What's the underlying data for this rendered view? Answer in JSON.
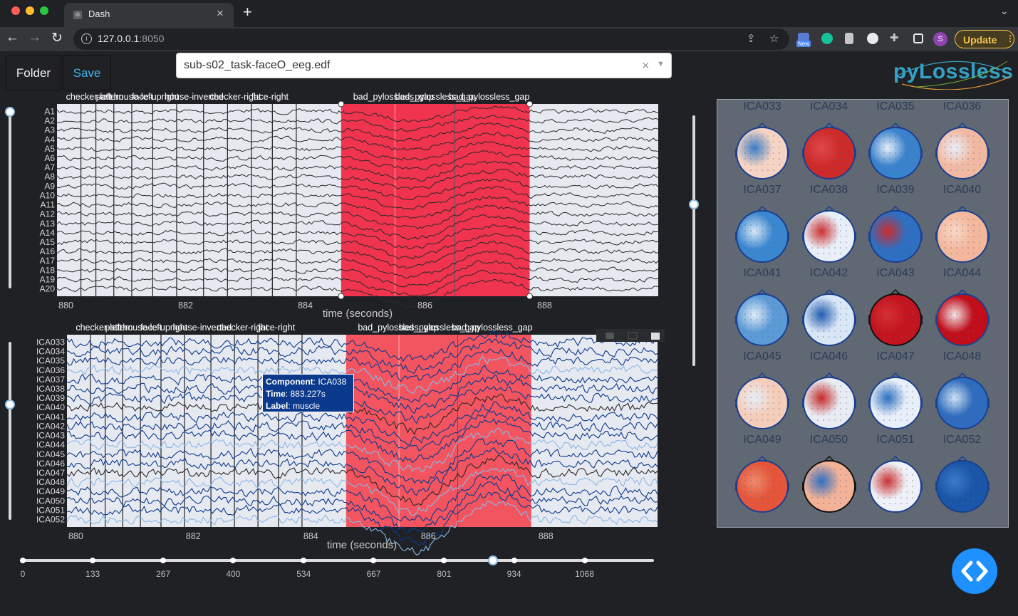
{
  "browser": {
    "tab_title": "Dash",
    "url_host": "127.0.0.1",
    "url_port": ":8050",
    "update_label": "Update",
    "new_badge": "New",
    "profile_initial": "S"
  },
  "app": {
    "folder_label": "Folder",
    "save_label": "Save",
    "file_value": "sub-s02_task-faceO_eeg.edf",
    "logo_text": "pyLossless"
  },
  "eeg_plot": {
    "channels": [
      "A1",
      "A2",
      "A3",
      "A4",
      "A5",
      "A6",
      "A7",
      "A8",
      "A9",
      "A10",
      "A11",
      "A12",
      "A13",
      "A14",
      "A15",
      "A16",
      "A17",
      "A18",
      "A19",
      "A20"
    ],
    "x_ticks": [
      "880",
      "882",
      "884",
      "886",
      "888"
    ],
    "x_label": "time (seconds)",
    "annotations": [
      "checker-left",
      "pattern",
      "house-left",
      "face-upright",
      "house-inverted",
      "checker-right",
      "face-right",
      "bad_pylossless_gap",
      "bad_pylossless_gap",
      "bad_pylossless_gap"
    ]
  },
  "ica_plot": {
    "components": [
      "ICA033",
      "ICA034",
      "ICA035",
      "ICA036",
      "ICA037",
      "ICA038",
      "ICA039",
      "ICA040",
      "ICA041",
      "ICA042",
      "ICA043",
      "ICA044",
      "ICA045",
      "ICA046",
      "ICA047",
      "ICA048",
      "ICA049",
      "ICA050",
      "ICA051",
      "ICA052"
    ],
    "x_ticks": [
      "880",
      "882",
      "884",
      "886",
      "888"
    ],
    "x_label": "time (seconds)",
    "tooltip": {
      "component_key": "Component",
      "component_val": ": ICA038",
      "time_key": "Time",
      "time_val": ": 883.227s",
      "label_key": "Label",
      "label_val": ": muscle"
    }
  },
  "time_slider": {
    "marks": [
      "0",
      "133",
      "267",
      "400",
      "534",
      "667",
      "801",
      "934",
      "1068"
    ],
    "value": 894
  },
  "topomaps": [
    "ICA033",
    "ICA034",
    "ICA035",
    "ICA036",
    "ICA037",
    "ICA038",
    "ICA039",
    "ICA040",
    "ICA041",
    "ICA042",
    "ICA043",
    "ICA044",
    "ICA045",
    "ICA046",
    "ICA047",
    "ICA048",
    "ICA049",
    "ICA050",
    "ICA051",
    "ICA052"
  ],
  "colors": {
    "bad_region": "#f0334f",
    "bad_region_ica": "#f25560",
    "plot_bg": "#e7e9f1",
    "ica_trace": "#0b3a8c",
    "ica_trace_light": "#8ab8e6",
    "accent": "#1e90ff"
  }
}
